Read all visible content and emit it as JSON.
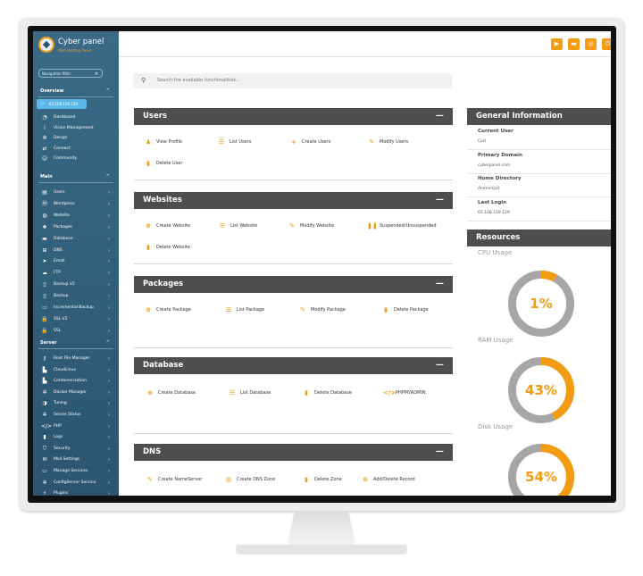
{
  "brand": {
    "name": "Cyber panel",
    "subtitle": "Web Hosting Panel"
  },
  "sidebar": {
    "filter_placeholder": "Navigation filter",
    "overview_label": "Overview",
    "ip_badge": "65.108.159.129",
    "overview_items": [
      {
        "label": "Dashboard",
        "icon": "dashboard-icon",
        "glyph": "◔"
      },
      {
        "label": "Vision Management",
        "icon": "info-icon",
        "glyph": "i"
      },
      {
        "label": "Design",
        "icon": "gear-icon",
        "glyph": "✲"
      },
      {
        "label": "Connect",
        "icon": "connect-icon",
        "glyph": "⇄"
      },
      {
        "label": "Community",
        "icon": "community-icon",
        "glyph": "☺"
      }
    ],
    "main_label": "Main",
    "main_items": [
      {
        "label": "Users",
        "icon": "users-icon",
        "glyph": "▤"
      },
      {
        "label": "Wordpress",
        "icon": "wordpress-icon",
        "glyph": "Ⓦ"
      },
      {
        "label": "Website",
        "icon": "globe-icon",
        "glyph": "◍"
      },
      {
        "label": "Packages",
        "icon": "packages-icon",
        "glyph": "❖"
      },
      {
        "label": "Database",
        "icon": "database-icon",
        "glyph": "▬"
      },
      {
        "label": "DNS",
        "icon": "dns-icon",
        "glyph": "⊞"
      },
      {
        "label": "Email",
        "icon": "send-icon",
        "glyph": "➤"
      },
      {
        "label": "FTP",
        "icon": "cloud-icon",
        "glyph": "☁"
      },
      {
        "label": "Backup V2",
        "icon": "file-icon",
        "glyph": "▯"
      },
      {
        "label": "Backup",
        "icon": "file-icon",
        "glyph": "▯"
      },
      {
        "label": "Incremental Backup",
        "icon": "folder-icon",
        "glyph": "▭"
      },
      {
        "label": "SSL V2",
        "icon": "lock-icon",
        "glyph": "🔒"
      },
      {
        "label": "SSL",
        "icon": "lock-icon",
        "glyph": "🔒"
      }
    ],
    "server_label": "Server",
    "server_items": [
      {
        "label": "Root File Manager",
        "icon": "key-icon",
        "glyph": "⚷"
      },
      {
        "label": "CloudLinux",
        "icon": "file-icon",
        "glyph": "▙"
      },
      {
        "label": "Containerization",
        "icon": "file-icon",
        "glyph": "▙"
      },
      {
        "label": "Docker Manager",
        "icon": "gear-icon",
        "glyph": "✲"
      },
      {
        "label": "Tuning",
        "icon": "contrast-icon",
        "glyph": "◑"
      },
      {
        "label": "Server Status",
        "icon": "gear-icon",
        "glyph": "✲"
      },
      {
        "label": "PHP",
        "icon": "code-icon",
        "glyph": "</>"
      },
      {
        "label": "Logs",
        "icon": "file-icon",
        "glyph": "▮"
      },
      {
        "label": "Security",
        "icon": "shield-icon",
        "glyph": "⛉"
      },
      {
        "label": "Mail Settings",
        "icon": "mail-icon",
        "glyph": "✉"
      },
      {
        "label": "Manage Services",
        "icon": "folder-icon",
        "glyph": "▭"
      },
      {
        "label": "ConfigServer Service",
        "icon": "gear-icon",
        "glyph": "✲"
      },
      {
        "label": "Plugins",
        "icon": "plugin-icon",
        "glyph": "⚡"
      }
    ]
  },
  "topbar": {
    "buttons": [
      {
        "name": "youtube-icon",
        "glyph": "▶"
      },
      {
        "name": "chat-icon",
        "glyph": "▬"
      },
      {
        "name": "help-icon",
        "glyph": "◎"
      },
      {
        "name": "power-icon",
        "glyph": "⏻"
      }
    ]
  },
  "search": {
    "placeholder": "Search the available functionalities..."
  },
  "panels": {
    "users": {
      "title": "Users",
      "actions": [
        {
          "label": "View Profile",
          "icon": "user-icon",
          "glyph": "♟"
        },
        {
          "label": "List Users",
          "icon": "list-users-icon",
          "glyph": "☰"
        },
        {
          "label": "Create Users",
          "icon": "user-plus-icon",
          "glyph": "+"
        },
        {
          "label": "Modify Users",
          "icon": "user-edit-icon",
          "glyph": "✎"
        },
        {
          "label": "Delete User",
          "icon": "trash-icon",
          "glyph": "▮"
        }
      ]
    },
    "websites": {
      "title": "Websites",
      "actions": [
        {
          "label": "Create Website",
          "icon": "plus-circle-icon",
          "glyph": "⊕"
        },
        {
          "label": "List Website",
          "icon": "list-icon",
          "glyph": "☰"
        },
        {
          "label": "Modify Website",
          "icon": "edit-icon",
          "glyph": "✎"
        },
        {
          "label": "Suspended/Unsuspended",
          "icon": "pause-icon",
          "glyph": "❚❚"
        },
        {
          "label": "Delete Website",
          "icon": "trash-icon",
          "glyph": "▮"
        }
      ]
    },
    "packages": {
      "title": "Packages",
      "actions": [
        {
          "label": "Create Package",
          "icon": "plus-circle-icon",
          "glyph": "⊕"
        },
        {
          "label": "List Package",
          "icon": "list-icon",
          "glyph": "☰"
        },
        {
          "label": "Modify Package",
          "icon": "edit-icon",
          "glyph": "✎"
        },
        {
          "label": "Delete Package",
          "icon": "trash-icon",
          "glyph": "▮"
        }
      ]
    },
    "database": {
      "title": "Database",
      "actions": [
        {
          "label": "Create Database",
          "icon": "plus-circle-icon",
          "glyph": "⊕"
        },
        {
          "label": "List Database",
          "icon": "list-icon",
          "glyph": "☰"
        },
        {
          "label": "Delete Database",
          "icon": "trash-icon",
          "glyph": "▮"
        },
        {
          "label": "PHPMYADMIN",
          "icon": "code-icon",
          "glyph": "</>"
        }
      ]
    },
    "dns": {
      "title": "DNS",
      "actions": [
        {
          "label": "Create NameServer",
          "icon": "pencil-icon",
          "glyph": "✎"
        },
        {
          "label": "Create DNS Zone",
          "icon": "globe-icon",
          "glyph": "◍"
        },
        {
          "label": "Delete Zone",
          "icon": "trash-icon",
          "glyph": "▮"
        },
        {
          "label": "Add/Delete Record",
          "icon": "plus-circle-icon",
          "glyph": "⊕"
        }
      ]
    }
  },
  "collapse_glyph": "—",
  "caret_glyph": "›",
  "caret_up_glyph": "^",
  "general_info": {
    "title": "General Information",
    "items": [
      {
        "key": "Current User",
        "value": "Cpd"
      },
      {
        "key": "Primary Domain",
        "value": "cyberpanel.com"
      },
      {
        "key": "Home Directory",
        "value": "/home/cpd"
      },
      {
        "key": "Last Login",
        "value": "65.108.159.129"
      }
    ]
  },
  "resources": {
    "title": "Resources",
    "gauges": [
      {
        "label": "CPU Usage",
        "percent": 1,
        "display": "1%"
      },
      {
        "label": "RAM Usage",
        "percent": 43,
        "display": "43%"
      },
      {
        "label": "Disk Usage",
        "percent": 54,
        "display": "54%"
      }
    ]
  },
  "colors": {
    "accent": "#f39c12",
    "sidebar": "#2b5570",
    "panel_header": "#4e4e4e",
    "track": "#a6a6a6"
  }
}
